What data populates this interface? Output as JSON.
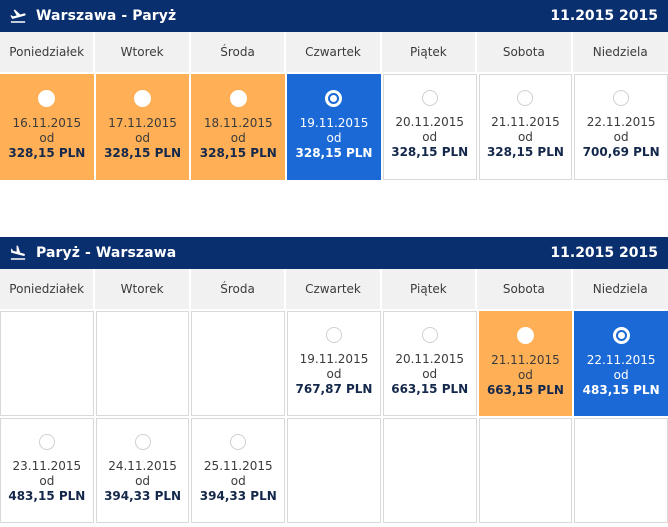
{
  "outbound": {
    "title": "Warszawa - Paryż",
    "month": "11.2015 2015",
    "days": [
      "Poniedziałek",
      "Wtorek",
      "Środa",
      "Czwartek",
      "Piątek",
      "Sobota",
      "Niedziela"
    ],
    "cells": [
      {
        "date": "16.11.2015",
        "od": "od",
        "price": "328,15 PLN",
        "state": "orange"
      },
      {
        "date": "17.11.2015",
        "od": "od",
        "price": "328,15 PLN",
        "state": "orange"
      },
      {
        "date": "18.11.2015",
        "od": "od",
        "price": "328,15 PLN",
        "state": "orange"
      },
      {
        "date": "19.11.2015",
        "od": "od",
        "price": "328,15 PLN",
        "state": "blue"
      },
      {
        "date": "20.11.2015",
        "od": "od",
        "price": "328,15 PLN",
        "state": "white"
      },
      {
        "date": "21.11.2015",
        "od": "od",
        "price": "328,15 PLN",
        "state": "white"
      },
      {
        "date": "22.11.2015",
        "od": "od",
        "price": "700,69 PLN",
        "state": "white"
      }
    ]
  },
  "return": {
    "title": "Paryż - Warszawa",
    "month": "11.2015 2015",
    "days": [
      "Poniedziałek",
      "Wtorek",
      "Środa",
      "Czwartek",
      "Piątek",
      "Sobota",
      "Niedziela"
    ],
    "cells": [
      {
        "date": "19.11.2015",
        "od": "od",
        "price": "767,87 PLN",
        "state": "white"
      },
      {
        "date": "20.11.2015",
        "od": "od",
        "price": "663,15 PLN",
        "state": "white"
      },
      {
        "date": "21.11.2015",
        "od": "od",
        "price": "663,15 PLN",
        "state": "orange"
      },
      {
        "date": "22.11.2015",
        "od": "od",
        "price": "483,15 PLN",
        "state": "blue"
      },
      {
        "date": "23.11.2015",
        "od": "od",
        "price": "483,15 PLN",
        "state": "white"
      },
      {
        "date": "24.11.2015",
        "od": "od",
        "price": "394,33 PLN",
        "state": "white"
      },
      {
        "date": "25.11.2015",
        "od": "od",
        "price": "394,33 PLN",
        "state": "white"
      }
    ]
  },
  "colors": {
    "header": "#0a2f6e",
    "selected": "#1b69d6",
    "cheapest": "#ffb057"
  },
  "icons": {
    "outbound": "plane-takeoff-icon",
    "return": "plane-landing-icon"
  }
}
